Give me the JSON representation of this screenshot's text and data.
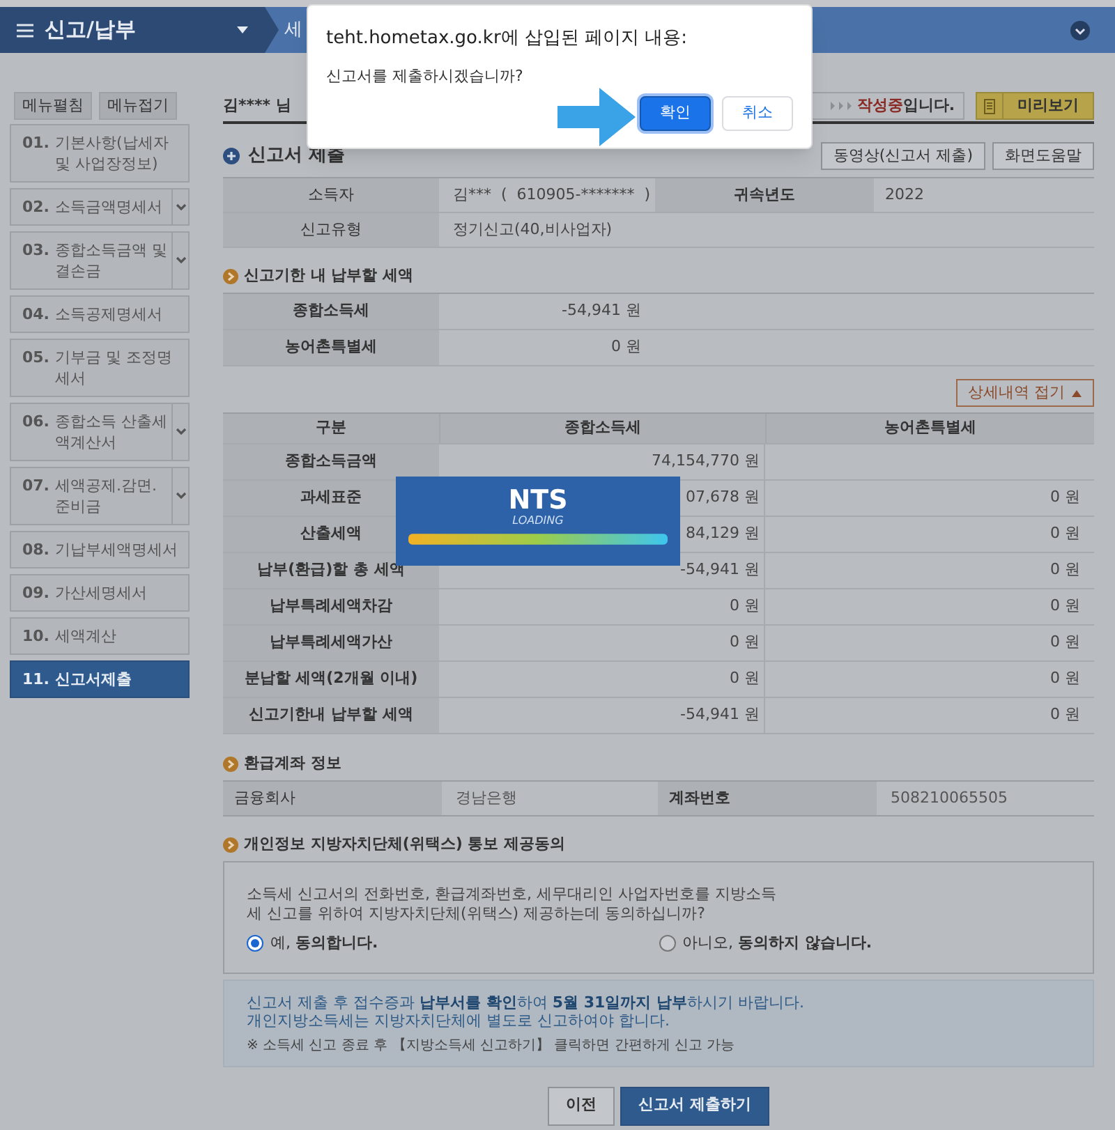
{
  "header": {
    "title": "신고/납부",
    "crumb": "세"
  },
  "sidebar": {
    "buttons": [
      "메뉴펼침",
      "메뉴접기"
    ],
    "items": [
      {
        "number": "01.",
        "label": "기본사항(납세자 및 사업장정보)",
        "expandable": false,
        "selected": false
      },
      {
        "number": "02.",
        "label": "소득금액명세서",
        "expandable": true,
        "selected": false
      },
      {
        "number": "03.",
        "label": "종합소득금액 및 결손금",
        "expandable": true,
        "selected": false
      },
      {
        "number": "04.",
        "label": "소득공제명세서",
        "expandable": false,
        "selected": false
      },
      {
        "number": "05.",
        "label": "기부금 및 조정명세서",
        "expandable": false,
        "selected": false
      },
      {
        "number": "06.",
        "label": "종합소득 산출세액계산서",
        "expandable": true,
        "selected": false
      },
      {
        "number": "07.",
        "label": "세액공제.감면.준비금",
        "expandable": true,
        "selected": false
      },
      {
        "number": "08.",
        "label": "기납부세액명세서",
        "expandable": false,
        "selected": false
      },
      {
        "number": "09.",
        "label": "가산세명세서",
        "expandable": false,
        "selected": false
      },
      {
        "number": "10.",
        "label": "세액계산",
        "expandable": false,
        "selected": false
      },
      {
        "number": "11.",
        "label": "신고서제출",
        "expandable": false,
        "selected": true
      }
    ]
  },
  "user_bar": {
    "user": "김**** 님",
    "status_highlight": "작성중",
    "status_rest": "입니다.",
    "preview_button": "미리보기"
  },
  "section": {
    "title": "신고서 제출",
    "buttons": [
      "동영상(신고서 제출)",
      "화면도움말"
    ]
  },
  "summary": [
    {
      "label": "소득자",
      "value": "김***  (  610905-*******  )",
      "label2": "귀속년도",
      "value2": "2022"
    },
    {
      "label": "신고유형",
      "value": "정기신고(40,비사업자)"
    }
  ],
  "due": {
    "title": "신고기한 내 납부할 세액",
    "rows": [
      {
        "label": "종합소득세",
        "value": "-54,941 원"
      },
      {
        "label": "농어촌특별세",
        "value": "0 원"
      }
    ]
  },
  "detail": {
    "toggle": "상세내역 접기",
    "columns": [
      "구분",
      "종합소득세",
      "농어촌특별세"
    ],
    "rows": [
      {
        "label": "종합소득금액",
        "income_tax": "74,154,770 원"
      },
      {
        "label": "과세표준",
        "income_tax": "07,678 원",
        "rural_tax": "0 원"
      },
      {
        "label": "산출세액",
        "income_tax": "84,129 원",
        "rural_tax": "0 원"
      },
      {
        "label": "납부(환급)할 총 세액",
        "income_tax": "-54,941 원",
        "rural_tax": "0 원"
      },
      {
        "label": "납부특례세액차감",
        "income_tax": "0 원",
        "rural_tax": "0 원"
      },
      {
        "label": "납부특례세액가산",
        "income_tax": "0 원",
        "rural_tax": "0 원"
      },
      {
        "label": "분납할 세액(2개월 이내)",
        "income_tax": "0 원",
        "rural_tax": "0 원"
      },
      {
        "label": "신고기한내 납부할 세액",
        "income_tax": "-54,941 원",
        "rural_tax": "0 원"
      }
    ]
  },
  "refund": {
    "title": "환급계좌 정보",
    "fields": [
      {
        "label": "금융회사",
        "value": "경남은행"
      },
      {
        "label": "계좌번호",
        "value": "508210065505"
      }
    ]
  },
  "consent": {
    "title": "개인정보 지방자치단체(위택스) 통보 제공동의",
    "question": "소득세 신고서의 전화번호, 환급계좌번호, 세무대리인 사업자번호를 지방소득세 신고를 위하여 지방자치단체(위택스) 제공하는데 동의하십니까?",
    "options": [
      {
        "label": "예, **동의합니다.**",
        "selected": true
      },
      {
        "label": "아니오, **동의하지 않습니다.**",
        "selected": false
      }
    ]
  },
  "notice": {
    "lines": [
      "신고서 제출 후 접수증과 **납부서를 확인**하여 **5월 31일까지 납부**하시기 바랍니다.",
      "개인지방소득세는 지방자치단체에 별도로 신고하여야 합니다."
    ],
    "note": "※ 소득세 신고 종료 후 【지방소득세 신고하기】 클릭하면 간편하게 신고 가능"
  },
  "footer_buttons": [
    {
      "label": "이전",
      "kind": "secondary"
    },
    {
      "label": "신고서 제출하기",
      "kind": "primary"
    }
  ],
  "loading": {
    "title": "NTS",
    "subtitle": "LOADING"
  },
  "dialog": {
    "title": "teht.hometax.go.kr에 삽입된 페이지 내용:",
    "message": "신고서를 제출하시겠습니까?",
    "buttons": [
      {
        "label": "확인",
        "kind": "primary"
      },
      {
        "label": "취소",
        "kind": "secondary"
      }
    ]
  }
}
